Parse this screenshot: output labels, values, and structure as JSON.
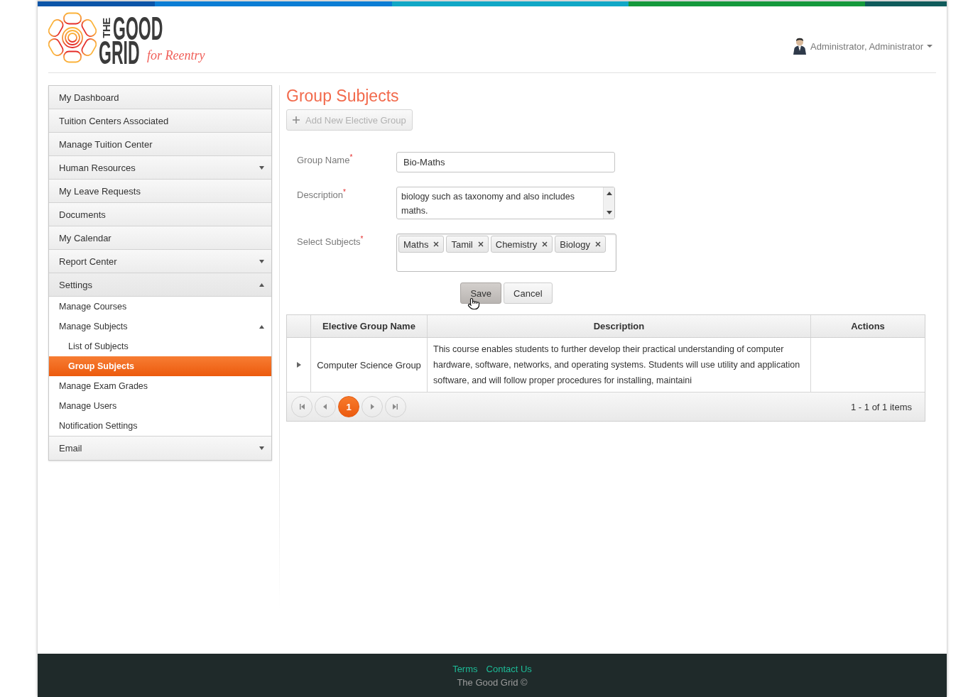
{
  "header": {
    "logo": {
      "side_word": "THE",
      "words": [
        "GOOD",
        "GRID"
      ],
      "tagline": "for Reentry"
    },
    "user_menu": {
      "label": "Administrator, Administrator"
    }
  },
  "sidebar": {
    "items": [
      {
        "label": "My Dashboard",
        "kind": "link",
        "selected": false
      },
      {
        "label": "Tuition Centers Associated",
        "kind": "link",
        "selected": false
      },
      {
        "label": "Manage Tuition Center",
        "kind": "link",
        "selected": false
      },
      {
        "label": "Human Resources",
        "kind": "group",
        "selected": false,
        "expanded": false
      },
      {
        "label": "My Leave Requests",
        "kind": "link",
        "selected": false
      },
      {
        "label": "Documents",
        "kind": "link",
        "selected": false
      },
      {
        "label": "My Calendar",
        "kind": "link",
        "selected": false
      },
      {
        "label": "Report Center",
        "kind": "group",
        "selected": false,
        "expanded": false
      },
      {
        "label": "Settings",
        "kind": "group",
        "selected": false,
        "expanded": true,
        "children": [
          {
            "label": "Manage Courses",
            "kind": "link",
            "selected": false
          },
          {
            "label": "Manage Subjects",
            "kind": "group",
            "selected": false,
            "expanded": true,
            "children": [
              {
                "label": "List of Subjects",
                "kind": "link",
                "selected": false
              },
              {
                "label": "Group Subjects",
                "kind": "link",
                "selected": true
              }
            ]
          },
          {
            "label": "Manage Exam Grades",
            "kind": "link",
            "selected": false
          },
          {
            "label": "Manage Users",
            "kind": "link",
            "selected": false
          },
          {
            "label": "Notification Settings",
            "kind": "link",
            "selected": false
          }
        ]
      },
      {
        "label": "Email",
        "kind": "group",
        "selected": false,
        "expanded": false
      }
    ]
  },
  "page": {
    "title": "Group Subjects",
    "add_button": {
      "label": "Add New Elective Group",
      "disabled": true
    }
  },
  "form": {
    "fields": [
      {
        "kind": "text",
        "label": "Group Name$^{*}$",
        "value": "Bio-Maths"
      },
      {
        "kind": "textarea",
        "label": "Description$^{*}$",
        "value": "biology such as taxonomy and also includes maths."
      },
      {
        "kind": "tags",
        "label": "Select Subjects$^{*}$",
        "tags": [
          "Maths",
          "Tamil",
          "Chemistry",
          "Biology"
        ]
      }
    ],
    "buttons": [
      {
        "label": "Save",
        "hovered": true
      },
      {
        "label": "Cancel",
        "hovered": false
      }
    ]
  },
  "table": {
    "columns": [
      "Elective Group Name",
      "Description",
      "Actions"
    ],
    "rows": [
      {
        "expanded": false,
        "group_name": "Computer Science Group",
        "description": "This course enables students to further develop their practical understanding of computer hardware, software, networks, and operating systems. Students will use utility and application software, and will follow proper procedures for installing, maintaini"
      }
    ],
    "pager": {
      "pages": [
        {
          "label": "1",
          "selected": true
        }
      ],
      "info": "1 - 1 of 1 items"
    }
  },
  "footer": {
    "links": [
      "Terms",
      "Contact Us"
    ],
    "copyright": "The Good Grid ©"
  }
}
